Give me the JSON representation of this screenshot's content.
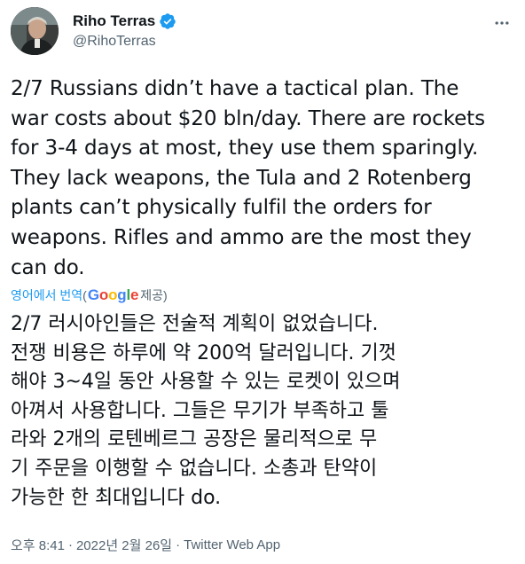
{
  "user": {
    "display_name": "Riho Terras",
    "handle": "@RihoTerras"
  },
  "icons": {
    "verified": "verified-badge-icon",
    "more": "more-options-icon"
  },
  "colors": {
    "text": "#0f1419",
    "secondary": "#536471",
    "accent": "#1d9bf0"
  },
  "tweet": {
    "text": "2/7 Russians didn’t have a tactical plan. The\nwar costs about $20 bln/day. There are rockets\nfor 3-4 days at most, they use them sparingly.\nThey lack weapons, the Tula and 2 Rotenberg\nplants can’t physically fulfil the orders for\nweapons. Rifles and ammo are the most they\ncan do."
  },
  "translation": {
    "link_label": "영어에서 번역",
    "open_paren": "(",
    "google_letters": [
      "G",
      "o",
      "o",
      "g",
      "l",
      "e"
    ],
    "provided": " 제공)",
    "text": "2/7 러시아인들은 전술적 계획이 없었습니다.\n전쟁 비용은 하루에 약 200억 달러입니다. 기껏\n해야 3~4일 동안 사용할 수 있는 로켓이 있으며\n아껴서 사용합니다. 그들은 무기가 부족하고 툴\n라와 2개의 로텐베르그 공장은 물리적으로 무\n기 주문을 이행할 수 없습니다. 소총과 탄약이\n가능한 한 최대입니다 do."
  },
  "meta": {
    "time": "오후 8:41",
    "dot1": "·",
    "date": "2022년 2월 26일",
    "dot2": "·",
    "source": "Twitter Web App"
  }
}
